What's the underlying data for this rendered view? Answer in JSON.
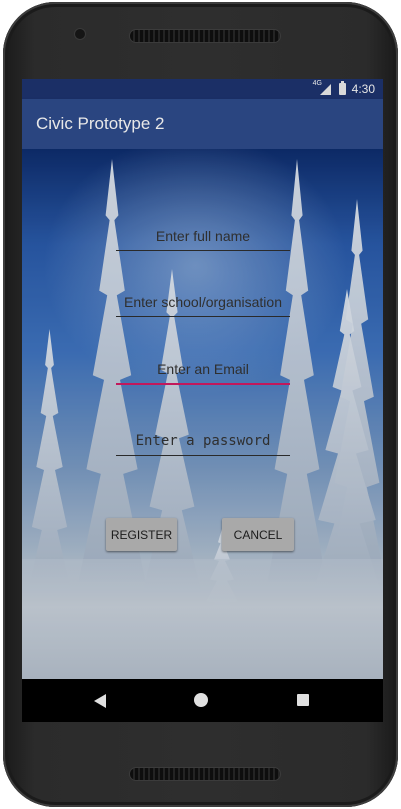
{
  "status_bar": {
    "network": "4G",
    "time": "4:30"
  },
  "app_bar": {
    "title": "Civic Prototype 2"
  },
  "form": {
    "full_name_placeholder": "Enter full name",
    "school_placeholder": "Enter school/organisation",
    "email_placeholder": "Enter an Email",
    "password_placeholder": "Enter a password"
  },
  "buttons": {
    "register": "REGISTER",
    "cancel": "CANCEL"
  },
  "nav_bar": {
    "back_icon": "triangle-back-icon",
    "home_icon": "circle-home-icon",
    "recents_icon": "square-recents-icon"
  },
  "colors": {
    "status_bar": "#1b2f66",
    "app_bar": "#2a4580",
    "focus_underline": "#c2185b",
    "button": "#a9a9a9"
  }
}
